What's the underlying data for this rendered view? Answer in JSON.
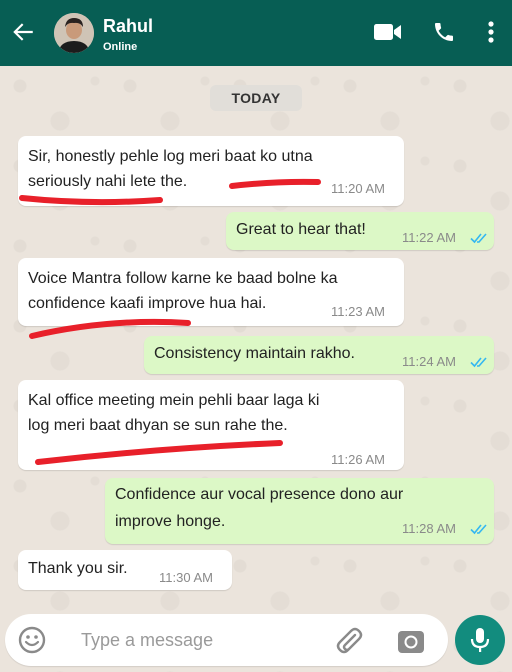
{
  "header": {
    "contact_name": "Rahul",
    "contact_status": "Online",
    "back_icon": "arrow-left-icon",
    "video_icon": "video-call-icon",
    "call_icon": "phone-icon",
    "menu_icon": "more-vertical-icon"
  },
  "chat": {
    "date_label": "TODAY",
    "messages": [
      {
        "direction": "incoming",
        "lines": [
          "Sir, honestly pehle log meri baat ko utna",
          "seriously nahi lete the."
        ],
        "time": "11:20 AM",
        "underlined": true
      },
      {
        "direction": "outgoing",
        "lines": [
          "Great to hear that!"
        ],
        "time": "11:22 AM",
        "status": "read"
      },
      {
        "direction": "incoming",
        "lines": [
          "Voice Mantra follow karne ke baad bolne ka",
          "confidence kaafi improve hua hai."
        ],
        "time": "11:23 AM",
        "underlined": true
      },
      {
        "direction": "outgoing",
        "lines": [
          "Consistency maintain rakho."
        ],
        "time": "11:24 AM",
        "status": "read"
      },
      {
        "direction": "incoming",
        "lines": [
          "Kal office meeting mein pehli baar laga ki",
          "log meri baat dhyan se sun rahe the."
        ],
        "time": "11:26 AM",
        "underlined": true
      },
      {
        "direction": "outgoing",
        "lines": [
          "Confidence aur vocal presence dono aur",
          "improve honge."
        ],
        "time": "11:28 AM",
        "status": "read"
      },
      {
        "direction": "incoming",
        "lines": [
          "Thank you sir."
        ],
        "time": "11:30 AM"
      }
    ]
  },
  "composer": {
    "placeholder": "Type a message",
    "emoji_icon": "emoji-icon",
    "attach_icon": "paperclip-icon",
    "camera_icon": "camera-icon",
    "mic_icon": "microphone-icon"
  },
  "colors": {
    "header_bg": "#075e54",
    "outgoing_bubble": "#dcf8c6",
    "incoming_bubble": "#ffffff",
    "read_ticks": "#34b7f1",
    "annotation_red": "#e8202a",
    "mic_button": "#128c7e"
  }
}
